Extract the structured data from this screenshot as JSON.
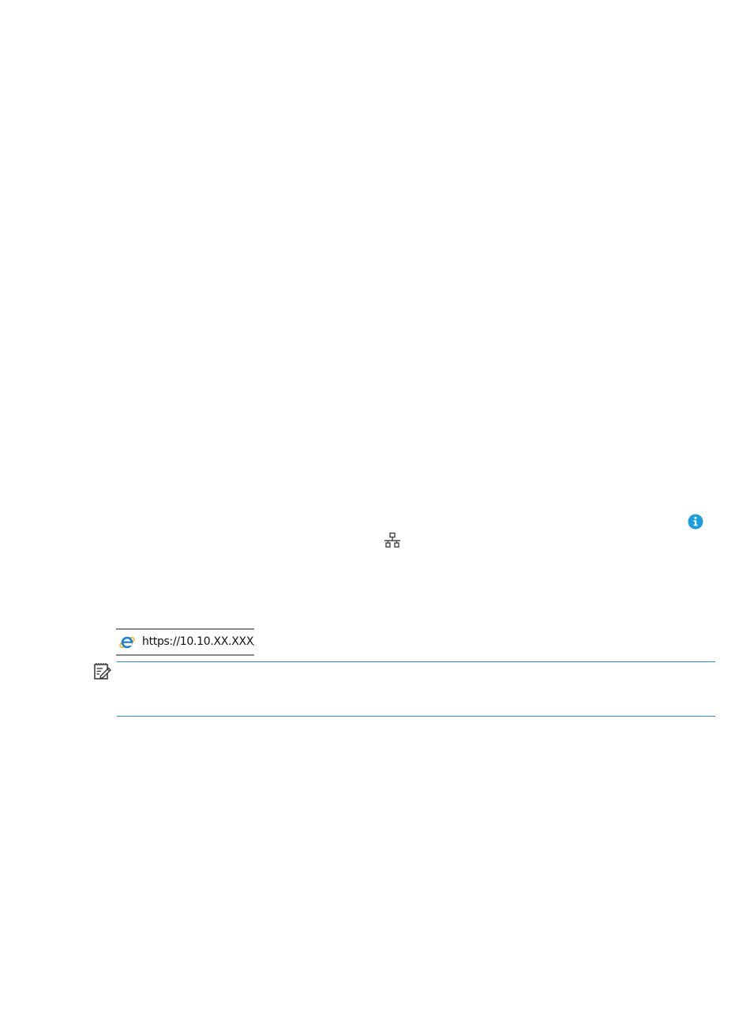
{
  "icons": {
    "info": "info-icon",
    "network": "network-icon",
    "browser": "internet-explorer-icon",
    "note": "note-icon"
  },
  "address_bar": {
    "url": "https://10.10.XX.XXX/"
  },
  "colors": {
    "accent_blue": "#1a9ee0",
    "rule_blue": "#2a8fd0",
    "icon_gray": "#444444"
  }
}
